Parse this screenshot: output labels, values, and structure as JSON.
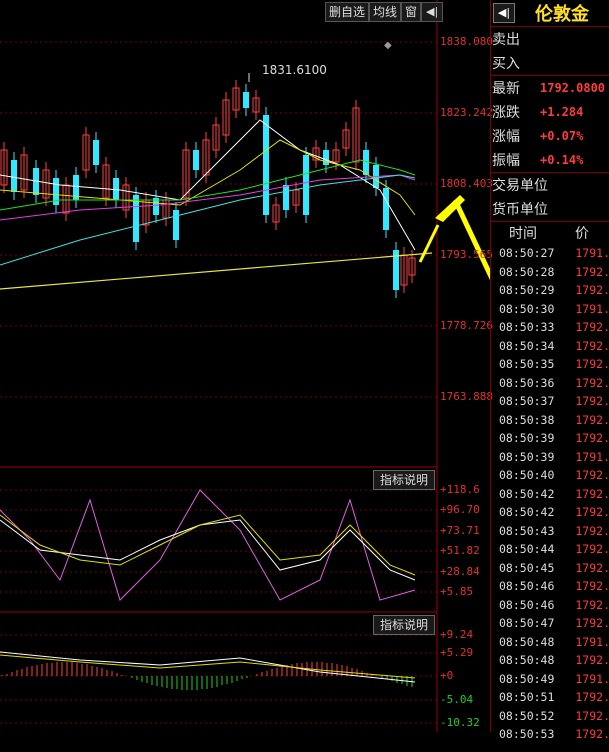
{
  "toolbar": {
    "btn1": "删自选",
    "btn2": "均线",
    "btn3": "窗",
    "btn4": "◀|"
  },
  "chart": {
    "price_labels": [
      "1838.080",
      "1823.242",
      "1808.403",
      "1793.565",
      "1778.726",
      "1763.888"
    ],
    "peak_label": "1831.6100",
    "indicator1": {
      "button": "指标说明",
      "labels": [
        "+118.6",
        "+96.70",
        "+73.71",
        "+51.82",
        "+28.84",
        "+5.85"
      ]
    },
    "indicator2": {
      "button": "指标说明",
      "labels": [
        "+9.24",
        "+5.29",
        "+0",
        "-5.04",
        "-10.32"
      ]
    }
  },
  "side": {
    "arrow": "◀|",
    "title": "伦敦金",
    "rows": [
      {
        "label": "卖出",
        "value": ""
      },
      {
        "label": "买入",
        "value": ""
      },
      {
        "label": "最新",
        "value": "1792.0800"
      },
      {
        "label": "涨跌",
        "value": "+1.284"
      },
      {
        "label": "涨幅",
        "value": "+0.07%"
      },
      {
        "label": "振幅",
        "value": "+0.14%"
      },
      {
        "label": "交易单位",
        "value": ""
      },
      {
        "label": "货币单位",
        "value": ""
      }
    ],
    "tick_header": {
      "time": "时间",
      "price": "价"
    },
    "ticks": [
      {
        "time": "08:50:27",
        "price": "1791."
      },
      {
        "time": "08:50:28",
        "price": "1792."
      },
      {
        "time": "08:50:29",
        "price": "1792."
      },
      {
        "time": "08:50:30",
        "price": "1791."
      },
      {
        "time": "08:50:33",
        "price": "1792."
      },
      {
        "time": "08:50:34",
        "price": "1792."
      },
      {
        "time": "08:50:35",
        "price": "1792."
      },
      {
        "time": "08:50:36",
        "price": "1792."
      },
      {
        "time": "08:50:37",
        "price": "1792."
      },
      {
        "time": "08:50:38",
        "price": "1792."
      },
      {
        "time": "08:50:39",
        "price": "1792."
      },
      {
        "time": "08:50:39",
        "price": "1791."
      },
      {
        "time": "08:50:40",
        "price": "1792."
      },
      {
        "time": "08:50:42",
        "price": "1792."
      },
      {
        "time": "08:50:42",
        "price": "1792."
      },
      {
        "time": "08:50:43",
        "price": "1792."
      },
      {
        "time": "08:50:44",
        "price": "1792."
      },
      {
        "time": "08:50:45",
        "price": "1792."
      },
      {
        "time": "08:50:46",
        "price": "1792."
      },
      {
        "time": "08:50:46",
        "price": "1792."
      },
      {
        "time": "08:50:47",
        "price": "1792."
      },
      {
        "time": "08:50:48",
        "price": "1791."
      },
      {
        "time": "08:50:48",
        "price": "1792."
      },
      {
        "time": "08:50:49",
        "price": "1791."
      },
      {
        "time": "08:50:51",
        "price": "1792."
      },
      {
        "time": "08:50:52",
        "price": "1792."
      },
      {
        "time": "08:50:53",
        "price": "1792."
      }
    ]
  }
}
